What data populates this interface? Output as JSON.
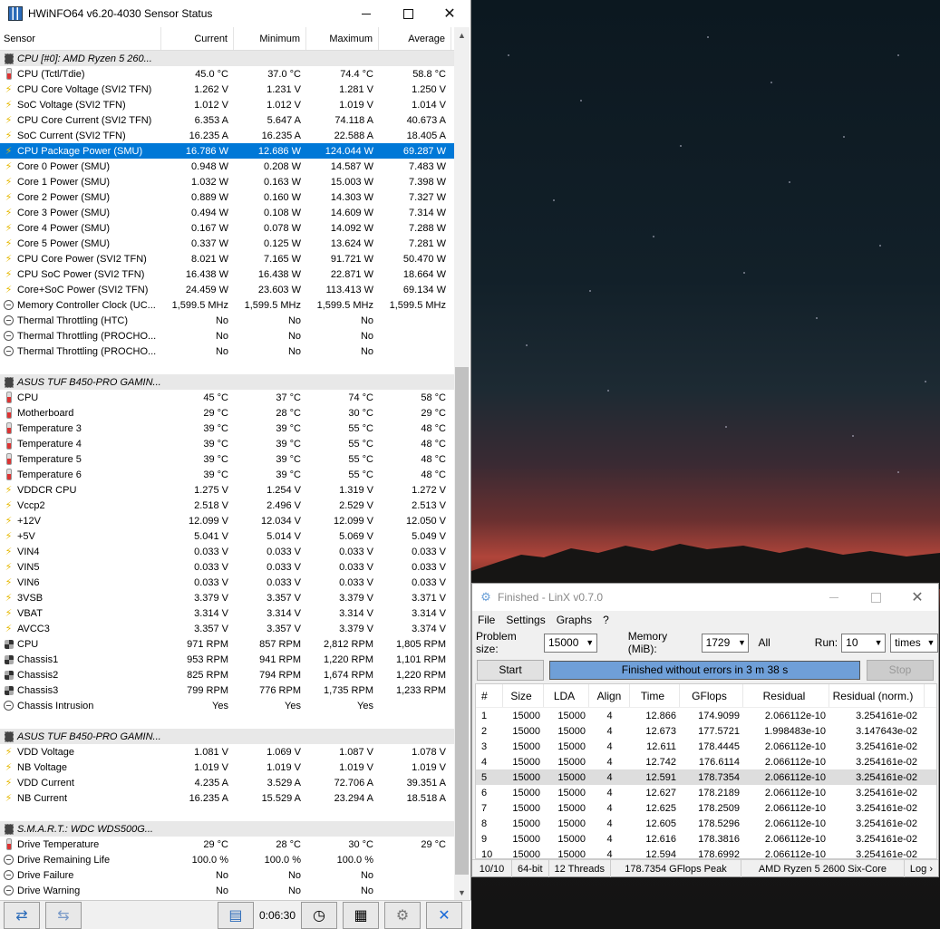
{
  "hwinfo": {
    "title": "HWiNFO64 v6.20-4030 Sensor Status",
    "headers": {
      "sensor": "Sensor",
      "current": "Current",
      "minimum": "Minimum",
      "maximum": "Maximum",
      "average": "Average"
    },
    "rows": [
      {
        "kind": "group",
        "name": "CPU [#0]: AMD Ryzen 5 260..."
      },
      {
        "kind": "row",
        "icon": "thermometer",
        "name": "CPU (Tctl/Tdie)",
        "cur": "45.0 °C",
        "min": "37.0 °C",
        "max": "74.4 °C",
        "avg": "58.8 °C"
      },
      {
        "kind": "row",
        "icon": "bolt",
        "name": "CPU Core Voltage (SVI2 TFN)",
        "cur": "1.262 V",
        "min": "1.231 V",
        "max": "1.281 V",
        "avg": "1.250 V"
      },
      {
        "kind": "row",
        "icon": "bolt",
        "name": "SoC Voltage (SVI2 TFN)",
        "cur": "1.012 V",
        "min": "1.012 V",
        "max": "1.019 V",
        "avg": "1.014 V"
      },
      {
        "kind": "row",
        "icon": "bolt",
        "name": "CPU Core Current (SVI2 TFN)",
        "cur": "6.353 A",
        "min": "5.647 A",
        "max": "74.118 A",
        "avg": "40.673 A"
      },
      {
        "kind": "row",
        "icon": "bolt",
        "name": "SoC Current (SVI2 TFN)",
        "cur": "16.235 A",
        "min": "16.235 A",
        "max": "22.588 A",
        "avg": "18.405 A"
      },
      {
        "kind": "row",
        "icon": "bolt",
        "selected": true,
        "name": "CPU Package Power (SMU)",
        "cur": "16.786 W",
        "min": "12.686 W",
        "max": "124.044 W",
        "avg": "69.287 W"
      },
      {
        "kind": "row",
        "icon": "bolt",
        "name": "Core 0 Power (SMU)",
        "cur": "0.948 W",
        "min": "0.208 W",
        "max": "14.587 W",
        "avg": "7.483 W"
      },
      {
        "kind": "row",
        "icon": "bolt",
        "name": "Core 1 Power (SMU)",
        "cur": "1.032 W",
        "min": "0.163 W",
        "max": "15.003 W",
        "avg": "7.398 W"
      },
      {
        "kind": "row",
        "icon": "bolt",
        "name": "Core 2 Power (SMU)",
        "cur": "0.889 W",
        "min": "0.160 W",
        "max": "14.303 W",
        "avg": "7.327 W"
      },
      {
        "kind": "row",
        "icon": "bolt",
        "name": "Core 3 Power (SMU)",
        "cur": "0.494 W",
        "min": "0.108 W",
        "max": "14.609 W",
        "avg": "7.314 W"
      },
      {
        "kind": "row",
        "icon": "bolt",
        "name": "Core 4 Power (SMU)",
        "cur": "0.167 W",
        "min": "0.078 W",
        "max": "14.092 W",
        "avg": "7.288 W"
      },
      {
        "kind": "row",
        "icon": "bolt",
        "name": "Core 5 Power (SMU)",
        "cur": "0.337 W",
        "min": "0.125 W",
        "max": "13.624 W",
        "avg": "7.281 W"
      },
      {
        "kind": "row",
        "icon": "bolt",
        "name": "CPU Core Power (SVI2 TFN)",
        "cur": "8.021 W",
        "min": "7.165 W",
        "max": "91.721 W",
        "avg": "50.470 W"
      },
      {
        "kind": "row",
        "icon": "bolt",
        "name": "CPU SoC Power (SVI2 TFN)",
        "cur": "16.438 W",
        "min": "16.438 W",
        "max": "22.871 W",
        "avg": "18.664 W"
      },
      {
        "kind": "row",
        "icon": "bolt",
        "name": "Core+SoC Power (SVI2 TFN)",
        "cur": "24.459 W",
        "min": "23.603 W",
        "max": "113.413 W",
        "avg": "69.134 W"
      },
      {
        "kind": "row",
        "icon": "minus",
        "name": "Memory Controller Clock (UC...",
        "cur": "1,599.5 MHz",
        "min": "1,599.5 MHz",
        "max": "1,599.5 MHz",
        "avg": "1,599.5 MHz"
      },
      {
        "kind": "row",
        "icon": "minus",
        "name": "Thermal Throttling (HTC)",
        "cur": "No",
        "min": "No",
        "max": "No",
        "avg": ""
      },
      {
        "kind": "row",
        "icon": "minus",
        "name": "Thermal Throttling (PROCHO...",
        "cur": "No",
        "min": "No",
        "max": "No",
        "avg": ""
      },
      {
        "kind": "row",
        "icon": "minus",
        "name": "Thermal Throttling (PROCHO...",
        "cur": "No",
        "min": "No",
        "max": "No",
        "avg": ""
      },
      {
        "kind": "spacer"
      },
      {
        "kind": "group",
        "name": "ASUS TUF B450-PRO GAMIN..."
      },
      {
        "kind": "row",
        "icon": "thermometer",
        "name": "CPU",
        "cur": "45 °C",
        "min": "37 °C",
        "max": "74 °C",
        "avg": "58 °C"
      },
      {
        "kind": "row",
        "icon": "thermometer",
        "name": "Motherboard",
        "cur": "29 °C",
        "min": "28 °C",
        "max": "30 °C",
        "avg": "29 °C"
      },
      {
        "kind": "row",
        "icon": "thermometer",
        "name": "Temperature 3",
        "cur": "39 °C",
        "min": "39 °C",
        "max": "55 °C",
        "avg": "48 °C"
      },
      {
        "kind": "row",
        "icon": "thermometer",
        "name": "Temperature 4",
        "cur": "39 °C",
        "min": "39 °C",
        "max": "55 °C",
        "avg": "48 °C"
      },
      {
        "kind": "row",
        "icon": "thermometer",
        "name": "Temperature 5",
        "cur": "39 °C",
        "min": "39 °C",
        "max": "55 °C",
        "avg": "48 °C"
      },
      {
        "kind": "row",
        "icon": "thermometer",
        "name": "Temperature 6",
        "cur": "39 °C",
        "min": "39 °C",
        "max": "55 °C",
        "avg": "48 °C"
      },
      {
        "kind": "row",
        "icon": "bolt",
        "name": "VDDCR CPU",
        "cur": "1.275 V",
        "min": "1.254 V",
        "max": "1.319 V",
        "avg": "1.272 V"
      },
      {
        "kind": "row",
        "icon": "bolt",
        "name": "Vccp2",
        "cur": "2.518 V",
        "min": "2.496 V",
        "max": "2.529 V",
        "avg": "2.513 V"
      },
      {
        "kind": "row",
        "icon": "bolt",
        "name": "+12V",
        "cur": "12.099 V",
        "min": "12.034 V",
        "max": "12.099 V",
        "avg": "12.050 V"
      },
      {
        "kind": "row",
        "icon": "bolt",
        "name": "+5V",
        "cur": "5.041 V",
        "min": "5.014 V",
        "max": "5.069 V",
        "avg": "5.049 V"
      },
      {
        "kind": "row",
        "icon": "bolt",
        "name": "VIN4",
        "cur": "0.033 V",
        "min": "0.033 V",
        "max": "0.033 V",
        "avg": "0.033 V"
      },
      {
        "kind": "row",
        "icon": "bolt",
        "name": "VIN5",
        "cur": "0.033 V",
        "min": "0.033 V",
        "max": "0.033 V",
        "avg": "0.033 V"
      },
      {
        "kind": "row",
        "icon": "bolt",
        "name": "VIN6",
        "cur": "0.033 V",
        "min": "0.033 V",
        "max": "0.033 V",
        "avg": "0.033 V"
      },
      {
        "kind": "row",
        "icon": "bolt",
        "name": "3VSB",
        "cur": "3.379 V",
        "min": "3.357 V",
        "max": "3.379 V",
        "avg": "3.371 V"
      },
      {
        "kind": "row",
        "icon": "bolt",
        "name": "VBAT",
        "cur": "3.314 V",
        "min": "3.314 V",
        "max": "3.314 V",
        "avg": "3.314 V"
      },
      {
        "kind": "row",
        "icon": "bolt",
        "name": "AVCC3",
        "cur": "3.357 V",
        "min": "3.357 V",
        "max": "3.379 V",
        "avg": "3.374 V"
      },
      {
        "kind": "row",
        "icon": "fan",
        "name": "CPU",
        "cur": "971 RPM",
        "min": "857 RPM",
        "max": "2,812 RPM",
        "avg": "1,805 RPM"
      },
      {
        "kind": "row",
        "icon": "fan",
        "name": "Chassis1",
        "cur": "953 RPM",
        "min": "941 RPM",
        "max": "1,220 RPM",
        "avg": "1,101 RPM"
      },
      {
        "kind": "row",
        "icon": "fan",
        "name": "Chassis2",
        "cur": "825 RPM",
        "min": "794 RPM",
        "max": "1,674 RPM",
        "avg": "1,220 RPM"
      },
      {
        "kind": "row",
        "icon": "fan",
        "name": "Chassis3",
        "cur": "799 RPM",
        "min": "776 RPM",
        "max": "1,735 RPM",
        "avg": "1,233 RPM"
      },
      {
        "kind": "row",
        "icon": "minus",
        "name": "Chassis Intrusion",
        "cur": "Yes",
        "min": "Yes",
        "max": "Yes",
        "avg": ""
      },
      {
        "kind": "spacer"
      },
      {
        "kind": "group",
        "name": "ASUS TUF B450-PRO GAMIN..."
      },
      {
        "kind": "row",
        "icon": "bolt",
        "name": "VDD Voltage",
        "cur": "1.081 V",
        "min": "1.069 V",
        "max": "1.087 V",
        "avg": "1.078 V"
      },
      {
        "kind": "row",
        "icon": "bolt",
        "name": "NB Voltage",
        "cur": "1.019 V",
        "min": "1.019 V",
        "max": "1.019 V",
        "avg": "1.019 V"
      },
      {
        "kind": "row",
        "icon": "bolt",
        "name": "VDD Current",
        "cur": "4.235 A",
        "min": "3.529 A",
        "max": "72.706 A",
        "avg": "39.351 A"
      },
      {
        "kind": "row",
        "icon": "bolt",
        "name": "NB Current",
        "cur": "16.235 A",
        "min": "15.529 A",
        "max": "23.294 A",
        "avg": "18.518 A"
      },
      {
        "kind": "spacer"
      },
      {
        "kind": "group",
        "name": "S.M.A.R.T.: WDC WDS500G..."
      },
      {
        "kind": "row",
        "icon": "thermometer",
        "name": "Drive Temperature",
        "cur": "29 °C",
        "min": "28 °C",
        "max": "30 °C",
        "avg": "29 °C"
      },
      {
        "kind": "row",
        "icon": "minus",
        "name": "Drive Remaining Life",
        "cur": "100.0 %",
        "min": "100.0 %",
        "max": "100.0 %",
        "avg": ""
      },
      {
        "kind": "row",
        "icon": "minus",
        "name": "Drive Failure",
        "cur": "No",
        "min": "No",
        "max": "No",
        "avg": ""
      },
      {
        "kind": "row",
        "icon": "minus",
        "name": "Drive Warning",
        "cur": "No",
        "min": "No",
        "max": "No",
        "avg": ""
      }
    ],
    "status_time": "0:06:30"
  },
  "linx": {
    "title": "Finished - LinX v0.7.0",
    "menu": [
      "File",
      "Settings",
      "Graphs",
      "?"
    ],
    "problem_size_label": "Problem size:",
    "problem_size": "15000",
    "memory_label": "Memory (MiB):",
    "memory": "1729",
    "all_label": "All",
    "run_label": "Run:",
    "run": "10",
    "run_unit": "times",
    "start_label": "Start",
    "progress_text": "Finished without errors in 3 m 38 s",
    "progress_fraction": 1.0,
    "stop_label": "Stop",
    "headers": [
      "#",
      "Size",
      "LDA",
      "Align",
      "Time",
      "GFlops",
      "Residual",
      "Residual (norm.)"
    ],
    "rows": [
      [
        "1",
        "15000",
        "15000",
        "4",
        "12.866",
        "174.9099",
        "2.066112e-10",
        "3.254161e-02"
      ],
      [
        "2",
        "15000",
        "15000",
        "4",
        "12.673",
        "177.5721",
        "1.998483e-10",
        "3.147643e-02"
      ],
      [
        "3",
        "15000",
        "15000",
        "4",
        "12.611",
        "178.4445",
        "2.066112e-10",
        "3.254161e-02"
      ],
      [
        "4",
        "15000",
        "15000",
        "4",
        "12.742",
        "176.6114",
        "2.066112e-10",
        "3.254161e-02"
      ],
      [
        "5",
        "15000",
        "15000",
        "4",
        "12.591",
        "178.7354",
        "2.066112e-10",
        "3.254161e-02"
      ],
      [
        "6",
        "15000",
        "15000",
        "4",
        "12.627",
        "178.2189",
        "2.066112e-10",
        "3.254161e-02"
      ],
      [
        "7",
        "15000",
        "15000",
        "4",
        "12.625",
        "178.2509",
        "2.066112e-10",
        "3.254161e-02"
      ],
      [
        "8",
        "15000",
        "15000",
        "4",
        "12.605",
        "178.5296",
        "2.066112e-10",
        "3.254161e-02"
      ],
      [
        "9",
        "15000",
        "15000",
        "4",
        "12.616",
        "178.3816",
        "2.066112e-10",
        "3.254161e-02"
      ],
      [
        "10",
        "15000",
        "15000",
        "4",
        "12.594",
        "178.6992",
        "2.066112e-10",
        "3.254161e-02"
      ]
    ],
    "highlight_row": "5",
    "status": {
      "count": "10/10",
      "bits": "64-bit",
      "threads": "12 Threads",
      "peak": "178.7354 GFlops Peak",
      "cpu": "AMD Ryzen 5 2600 Six-Core",
      "log": "Log ›"
    }
  },
  "colors": {
    "selection": "#0078d7",
    "progress": "#6f9fd8",
    "group_bg": "#e8e8e8"
  }
}
